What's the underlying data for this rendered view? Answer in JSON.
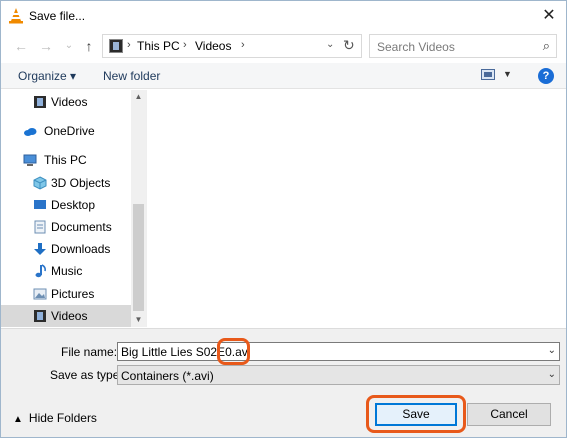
{
  "window": {
    "title": "Save file...",
    "close_glyph": "✕"
  },
  "nav": {
    "back": "←",
    "forward": "→",
    "recent": "⌄",
    "up": "↑"
  },
  "address": {
    "crumbs": [
      "This PC",
      "Videos"
    ],
    "separator": "›",
    "dropdown": "⌄",
    "refresh": "↻"
  },
  "search": {
    "placeholder": "Search Videos",
    "icon": "⌕"
  },
  "toolbar": {
    "organize": "Organize ▾",
    "new_folder": "New folder",
    "help": "?"
  },
  "sidebar": {
    "items": [
      {
        "label": "Videos",
        "icon": "video-folder-icon"
      },
      {
        "label": "OneDrive",
        "icon": "cloud-icon"
      },
      {
        "label": "This PC",
        "icon": "computer-icon"
      },
      {
        "label": "3D Objects",
        "icon": "cube-icon"
      },
      {
        "label": "Desktop",
        "icon": "desktop-icon"
      },
      {
        "label": "Documents",
        "icon": "document-icon"
      },
      {
        "label": "Downloads",
        "icon": "download-arrow-icon"
      },
      {
        "label": "Music",
        "icon": "music-note-icon"
      },
      {
        "label": "Pictures",
        "icon": "picture-icon"
      },
      {
        "label": "Videos",
        "icon": "video-folder-icon",
        "selected": true
      }
    ]
  },
  "form": {
    "file_name_label": "File name:",
    "file_name_value": "Big Little Lies S02E0.avi",
    "save_as_type_label": "Save as type:",
    "save_as_type_value": "Containers (*.avi)"
  },
  "footer": {
    "hide_folders": "Hide Folders",
    "save": "Save",
    "cancel": "Cancel"
  },
  "colors": {
    "highlight": "#e8591a",
    "accent": "#0078d7",
    "selected_row": "#d9d9d9"
  }
}
